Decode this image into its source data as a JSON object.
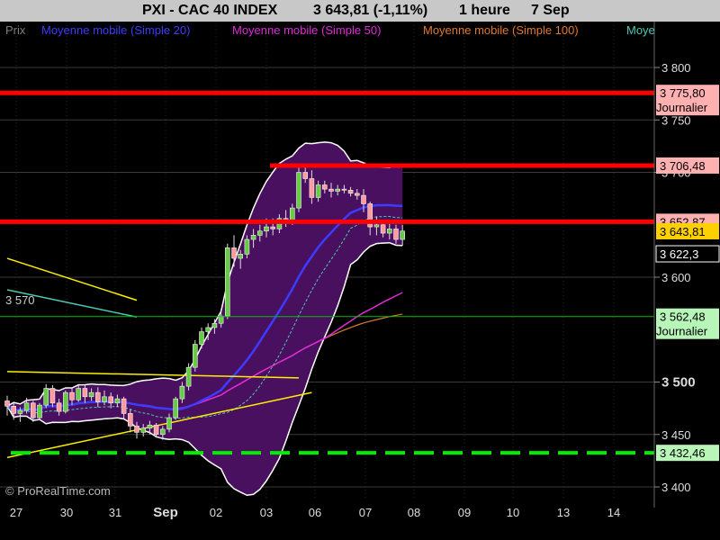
{
  "header": {
    "title": "PXI - CAC 40 INDEX",
    "price": "3 643,81 (-1,11%)",
    "timeframe": "1 heure",
    "date": "7 Sep"
  },
  "legend": [
    {
      "label": "Prix",
      "color": "#7f7f7f"
    },
    {
      "label": "Moyenne mobile (Simple 20)",
      "color": "#3c3cff"
    },
    {
      "label": "Moyenne mobile (Simple 50)",
      "color": "#e02ad8"
    },
    {
      "label": "Moyenne mobile (Simple 100)",
      "color": "#e07830"
    },
    {
      "label": "Moye",
      "color": "#4cc8b4"
    }
  ],
  "watermark": "© ProRealTime.com",
  "chart_data": {
    "type": "candlestick",
    "x_ticks": [
      "27",
      "30",
      "31",
      "Sep",
      "02",
      "03",
      "06",
      "07",
      "08",
      "09",
      "10",
      "13",
      "14"
    ],
    "y_ticks": [
      "3 800",
      "3 750",
      "3 700",
      "3 600",
      "3 500",
      "3 450",
      "3 400"
    ],
    "y_tick_bold": "3 500",
    "ylim": [
      3390,
      3810
    ],
    "candles": [
      [
        3482,
        3487,
        3468,
        3477
      ],
      [
        3477,
        3480,
        3464,
        3470
      ],
      [
        3470,
        3476,
        3462,
        3473
      ],
      [
        3473,
        3485,
        3470,
        3480
      ],
      [
        3480,
        3482,
        3462,
        3466
      ],
      [
        3466,
        3480,
        3464,
        3478
      ],
      [
        3478,
        3498,
        3475,
        3494
      ],
      [
        3494,
        3497,
        3476,
        3480
      ],
      [
        3480,
        3484,
        3468,
        3472
      ],
      [
        3472,
        3492,
        3470,
        3490
      ],
      [
        3490,
        3495,
        3478,
        3483
      ],
      [
        3483,
        3498,
        3481,
        3494
      ],
      [
        3494,
        3497,
        3480,
        3486
      ],
      [
        3486,
        3494,
        3482,
        3490
      ],
      [
        3490,
        3495,
        3476,
        3481
      ],
      [
        3481,
        3492,
        3478,
        3486
      ],
      [
        3486,
        3490,
        3475,
        3480
      ],
      [
        3480,
        3488,
        3476,
        3484
      ],
      [
        3484,
        3486,
        3465,
        3470
      ],
      [
        3470,
        3474,
        3452,
        3458
      ],
      [
        3458,
        3462,
        3446,
        3452
      ],
      [
        3452,
        3460,
        3448,
        3456
      ],
      [
        3456,
        3463,
        3450,
        3459
      ],
      [
        3459,
        3461,
        3447,
        3450
      ],
      [
        3450,
        3458,
        3445,
        3455
      ],
      [
        3455,
        3470,
        3452,
        3466
      ],
      [
        3466,
        3486,
        3464,
        3484
      ],
      [
        3484,
        3500,
        3480,
        3496
      ],
      [
        3496,
        3518,
        3492,
        3514
      ],
      [
        3514,
        3540,
        3510,
        3536
      ],
      [
        3536,
        3552,
        3532,
        3548
      ],
      [
        3548,
        3556,
        3540,
        3552
      ],
      [
        3552,
        3560,
        3546,
        3556
      ],
      [
        3556,
        3568,
        3552,
        3563
      ],
      [
        3563,
        3632,
        3560,
        3628
      ],
      [
        3628,
        3640,
        3610,
        3618
      ],
      [
        3618,
        3626,
        3608,
        3622
      ],
      [
        3622,
        3640,
        3618,
        3636
      ],
      [
        3636,
        3646,
        3628,
        3640
      ],
      [
        3640,
        3650,
        3634,
        3644
      ],
      [
        3644,
        3656,
        3638,
        3648
      ],
      [
        3648,
        3656,
        3640,
        3646
      ],
      [
        3646,
        3660,
        3642,
        3656
      ],
      [
        3656,
        3664,
        3648,
        3654
      ],
      [
        3654,
        3670,
        3650,
        3666
      ],
      [
        3666,
        3706,
        3662,
        3700
      ],
      [
        3700,
        3708,
        3690,
        3694
      ],
      [
        3694,
        3702,
        3670,
        3676
      ],
      [
        3676,
        3692,
        3672,
        3688
      ],
      [
        3688,
        3692,
        3680,
        3684
      ],
      [
        3684,
        3690,
        3676,
        3682
      ],
      [
        3682,
        3688,
        3678,
        3684
      ],
      [
        3684,
        3688,
        3680,
        3683
      ],
      [
        3683,
        3686,
        3677,
        3680
      ],
      [
        3680,
        3684,
        3674,
        3678
      ],
      [
        3678,
        3684,
        3662,
        3670
      ],
      [
        3670,
        3672,
        3640,
        3648
      ],
      [
        3648,
        3658,
        3640,
        3650
      ],
      [
        3650,
        3654,
        3638,
        3642
      ],
      [
        3642,
        3652,
        3636,
        3646
      ],
      [
        3646,
        3650,
        3632,
        3636
      ],
      [
        3636,
        3650,
        3630,
        3644
      ]
    ],
    "horizontal_levels": [
      {
        "value": 3775.8,
        "color": "#ff0000",
        "label": "3 775,80",
        "sublabel": "Journalier"
      },
      {
        "value": 3706.48,
        "color": "#ff0000",
        "label": "3 706,48",
        "sublabel": ""
      },
      {
        "value": 3652.87,
        "color": "#ff0000",
        "label": "3 652,87",
        "sublabel": ""
      },
      {
        "value": 3643.81,
        "color": "#ffdd00",
        "label": "3 643,81",
        "sublabel": ""
      },
      {
        "value": 3622.3,
        "color": "#ffffff",
        "label": "3 622,3",
        "sublabel": ""
      },
      {
        "value": 3562.48,
        "color": "#00c000",
        "label": "3 562,48",
        "sublabel": "Journalier"
      },
      {
        "value": 3432.46,
        "color": "#00ee00",
        "label": "3 432,46",
        "sublabel": ""
      }
    ],
    "level_label_left": "3 570",
    "trendlines": [
      {
        "from": [
          0,
          3618
        ],
        "to": [
          20,
          3578
        ],
        "color": "#ffee00"
      },
      {
        "from": [
          0,
          3510
        ],
        "to": [
          45,
          3504
        ],
        "color": "#ffee00"
      },
      {
        "from": [
          0,
          3428
        ],
        "to": [
          47,
          3490
        ],
        "color": "#ffee00"
      },
      {
        "from": [
          0,
          3588
        ],
        "to": [
          20,
          3562
        ],
        "color": "#4cc8b4"
      }
    ]
  }
}
